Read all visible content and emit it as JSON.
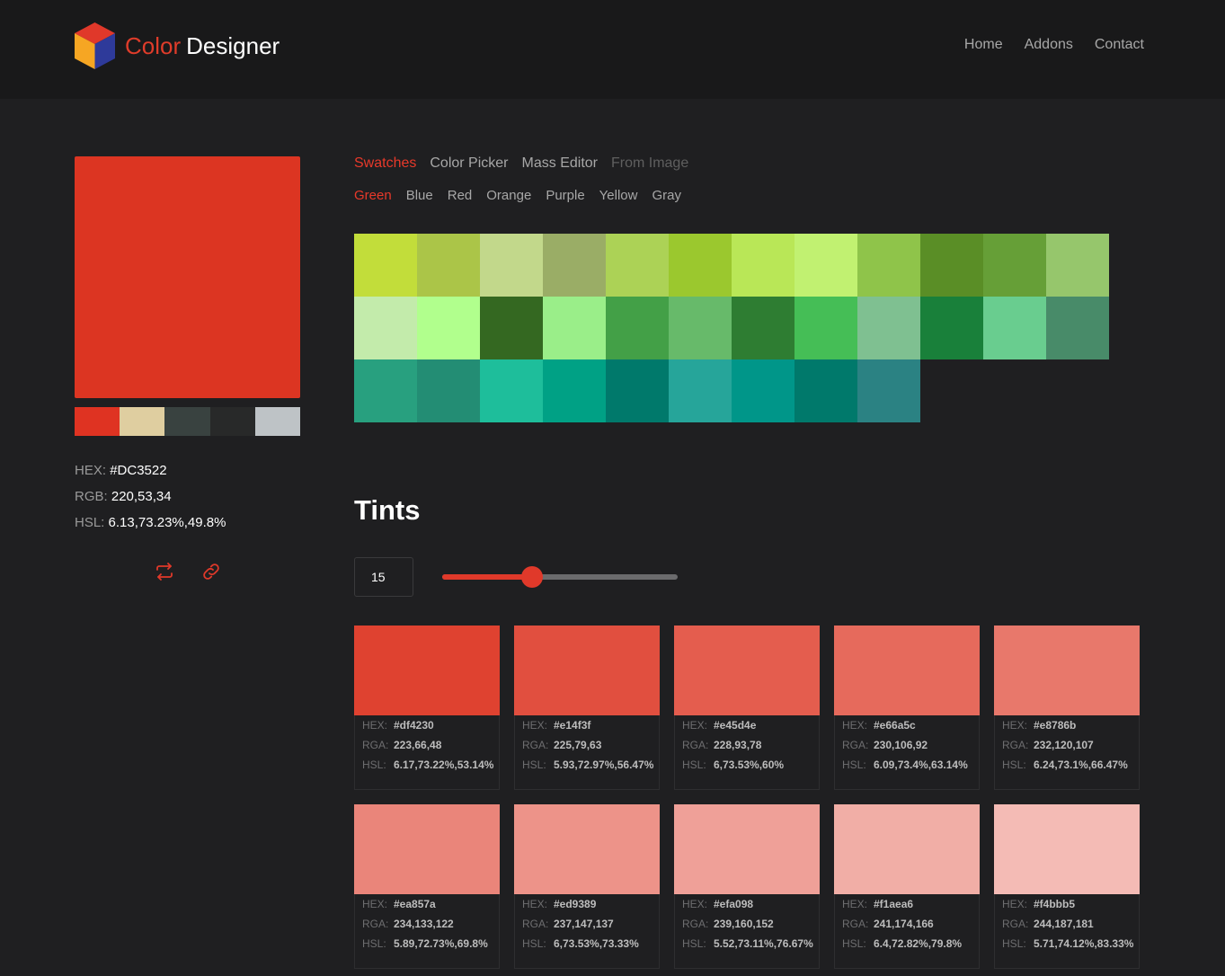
{
  "header": {
    "logo_word1": "Color",
    "logo_word2": "Designer",
    "nav": [
      "Home",
      "Addons",
      "Contact"
    ]
  },
  "current_color": {
    "color": "#DC3522",
    "palette": [
      "#df3322",
      "#dfcea0",
      "#394240",
      "#282929",
      "#bec3c6"
    ],
    "hex_label": "HEX:",
    "hex": "#DC3522",
    "rgb_label": "RGB:",
    "rgb": "220,53,34",
    "hsl_label": "HSL:",
    "hsl": "6.13,73.23%,49.8%",
    "action_icons": [
      "swap-icon",
      "link-icon"
    ]
  },
  "tabs": [
    "Swatches",
    "Color Picker",
    "Mass Editor",
    "From Image"
  ],
  "active_tab": "Swatches",
  "subtabs": [
    "Green",
    "Blue",
    "Red",
    "Orange",
    "Purple",
    "Yellow",
    "Gray"
  ],
  "active_subtab": "Green",
  "swatches": [
    "#c2dd3a",
    "#abc548",
    "#c2d88b",
    "#9aad66",
    "#acd256",
    "#9bc82e",
    "#b9e757",
    "#c1f171",
    "#8fc44a",
    "#5a8e26",
    "#669f37",
    "#96c66c",
    "#c3ebab",
    "#b1ff8d",
    "#346821",
    "#9aee89",
    "#43a047",
    "#67ba6a",
    "#2e7d32",
    "#45be56",
    "#7fc091",
    "#19803a",
    "#69cd8f",
    "#488b69",
    "#28a07f",
    "#238d74",
    "#1ebe9b",
    "#00a185",
    "#00796b",
    "#26a59a",
    "#009689",
    "#00796b",
    "#2b8283"
  ],
  "tints_title": "Tints",
  "tints_count": "15",
  "slider_fraction": 0.38,
  "tint_labels": {
    "hex": "HEX:",
    "rgb": "RGA:",
    "hsl": "HSL:"
  },
  "tints": [
    {
      "color": "#df4230",
      "hex": "#df4230",
      "rgb": "223,66,48",
      "hsl": "6.17,73.22%,53.14%"
    },
    {
      "color": "#e14f3f",
      "hex": "#e14f3f",
      "rgb": "225,79,63",
      "hsl": "5.93,72.97%,56.47%"
    },
    {
      "color": "#e45d4e",
      "hex": "#e45d4e",
      "rgb": "228,93,78",
      "hsl": "6,73.53%,60%"
    },
    {
      "color": "#e66a5c",
      "hex": "#e66a5c",
      "rgb": "230,106,92",
      "hsl": "6.09,73.4%,63.14%"
    },
    {
      "color": "#e8786b",
      "hex": "#e8786b",
      "rgb": "232,120,107",
      "hsl": "6.24,73.1%,66.47%"
    },
    {
      "color": "#ea857a",
      "hex": "#ea857a",
      "rgb": "234,133,122",
      "hsl": "5.89,72.73%,69.8%"
    },
    {
      "color": "#ed9389",
      "hex": "#ed9389",
      "rgb": "237,147,137",
      "hsl": "6,73.53%,73.33%"
    },
    {
      "color": "#efa098",
      "hex": "#efa098",
      "rgb": "239,160,152",
      "hsl": "5.52,73.11%,76.67%"
    },
    {
      "color": "#f1aea6",
      "hex": "#f1aea6",
      "rgb": "241,174,166",
      "hsl": "6.4,72.82%,79.8%"
    },
    {
      "color": "#f4bbb5",
      "hex": "#f4bbb5",
      "rgb": "244,187,181",
      "hsl": "5.71,74.12%,83.33%"
    }
  ]
}
